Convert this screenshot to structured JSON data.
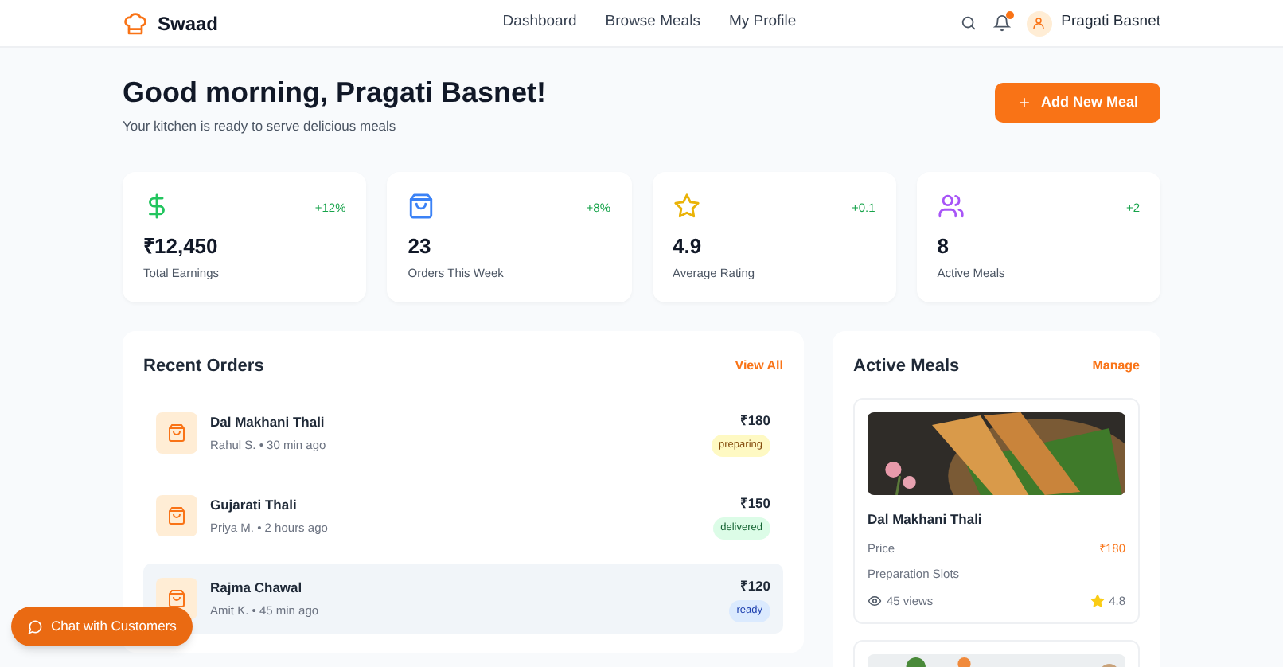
{
  "brand": "Swaad",
  "nav": [
    {
      "label": "Dashboard"
    },
    {
      "label": "Browse Meals"
    },
    {
      "label": "My Profile"
    }
  ],
  "notifications": {
    "unread": true
  },
  "user": {
    "name": "Pragati Basnet"
  },
  "greeting": {
    "title": "Good morning, Pragati Basnet!",
    "subtitle": "Your kitchen is ready to serve delicious meals"
  },
  "add_button": {
    "label": "Add New Meal"
  },
  "stats": [
    {
      "kind": "dollar",
      "color": "#22c55e",
      "value": "₹12,450",
      "label": "Total Earnings",
      "change": "+12%"
    },
    {
      "kind": "bag",
      "color": "#3b82f6",
      "value": "23",
      "label": "Orders This Week",
      "change": "+8%"
    },
    {
      "kind": "star",
      "color": "#eab308",
      "value": "4.9",
      "label": "Average Rating",
      "change": "+0.1"
    },
    {
      "kind": "users",
      "color": "#a855f7",
      "value": "8",
      "label": "Active Meals",
      "change": "+2"
    }
  ],
  "recent_orders": {
    "title": "Recent Orders",
    "link": "View All",
    "rows": [
      {
        "meal": "Dal Makhani Thali",
        "meta": "Rahul S. • 30 min ago",
        "price": "₹180",
        "status": "preparing",
        "kind": "preparing",
        "selected": false
      },
      {
        "meal": "Gujarati Thali",
        "meta": "Priya M. • 2 hours ago",
        "price": "₹150",
        "status": "delivered",
        "kind": "delivered",
        "selected": false
      },
      {
        "meal": "Rajma Chawal",
        "meta": "Amit K. • 45 min ago",
        "price": "₹120",
        "status": "ready",
        "kind": "ready",
        "selected": true
      }
    ]
  },
  "active_meals": {
    "title": "Active Meals",
    "link": "Manage",
    "meals": [
      {
        "name": "Dal Makhani Thali",
        "price_label": "Price",
        "price": "₹180",
        "slots_label": "Preparation Slots",
        "views": "45 views",
        "rating": "4.8"
      },
      {
        "kind": "picture"
      }
    ]
  },
  "chat_button": {
    "label": "Chat with Customers"
  }
}
